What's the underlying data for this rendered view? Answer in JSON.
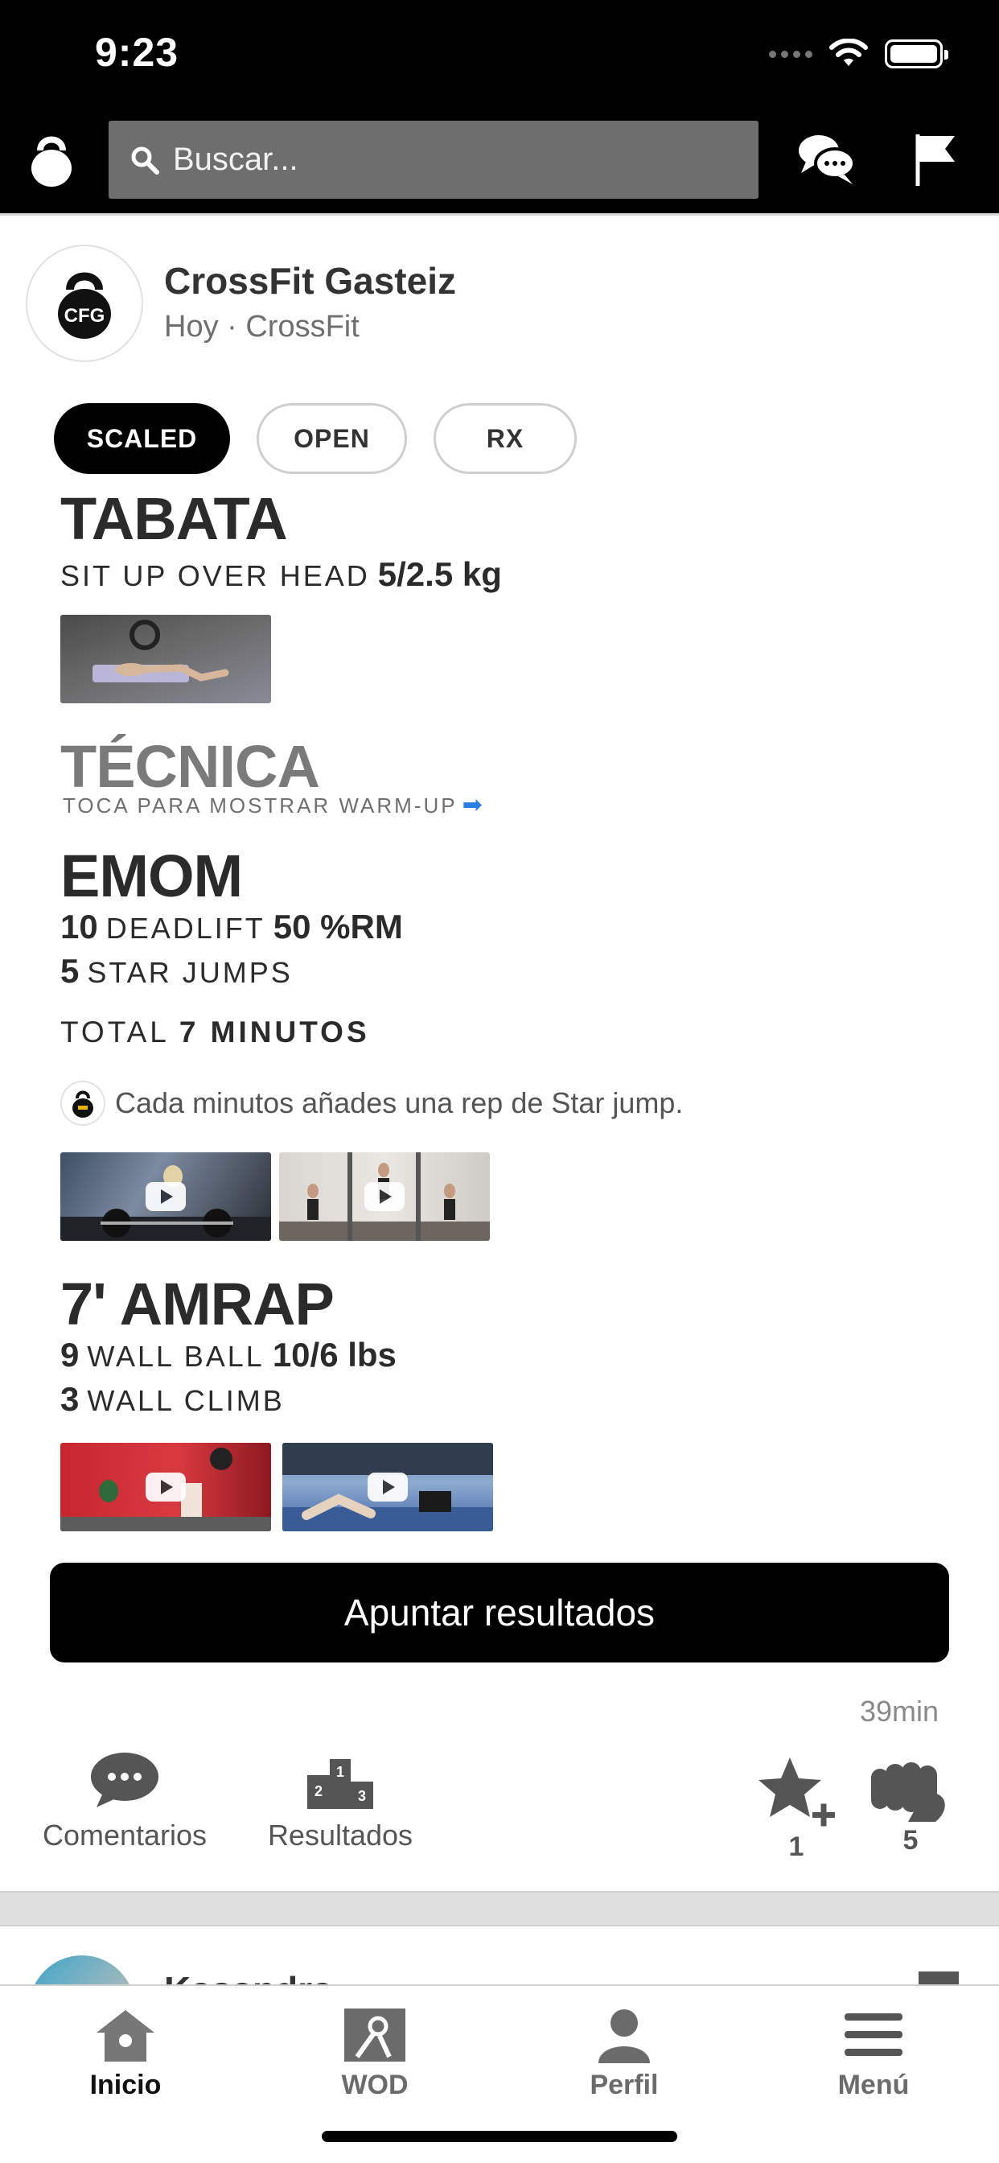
{
  "status_bar": {
    "time": "9:23"
  },
  "top_nav": {
    "search_placeholder": "Buscar..."
  },
  "post": {
    "gym_name": "CrossFit Gasteiz",
    "meta": "Hoy · CrossFit",
    "avatar_text": "CFG",
    "levels": [
      {
        "label": "SCALED",
        "active": true
      },
      {
        "label": "OPEN",
        "active": false
      },
      {
        "label": "RX",
        "active": false
      }
    ],
    "tabata": {
      "title": "TABATA",
      "movement": "SIT UP OVER HEAD",
      "load": "5/2.5 kg"
    },
    "tecnica": {
      "title": "TÉCNICA",
      "hint": "TOCA PARA MOSTRAR WARM-UP",
      "hint_arrow": "➡"
    },
    "emom": {
      "title": "EMOM",
      "lines": [
        {
          "reps": "10",
          "movement": "DEADLIFT",
          "load": "50 %RM"
        },
        {
          "reps": "5",
          "movement": "STAR JUMPS",
          "load": ""
        }
      ],
      "total_label": "TOTAL",
      "total_value": "7 MINUTOS",
      "note": "Cada minutos añades una rep de Star jump."
    },
    "amrap": {
      "title": "7' AMRAP",
      "lines": [
        {
          "reps": "9",
          "movement": "WALL BALL",
          "load": "10/6 lbs"
        },
        {
          "reps": "3",
          "movement": "WALL CLIMB",
          "load": ""
        }
      ]
    },
    "result_button": "Apuntar resultados",
    "time_ago": "39min",
    "actions": {
      "comments": "Comentarios",
      "results": "Resultados",
      "favorites_count": "1",
      "fistbump_count": "5"
    }
  },
  "next_post": {
    "name": "Kasandra"
  },
  "tab_bar": [
    {
      "label": "Inicio",
      "active": true
    },
    {
      "label": "WOD",
      "active": false
    },
    {
      "label": "Perfil",
      "active": false
    },
    {
      "label": "Menú",
      "active": false
    }
  ]
}
